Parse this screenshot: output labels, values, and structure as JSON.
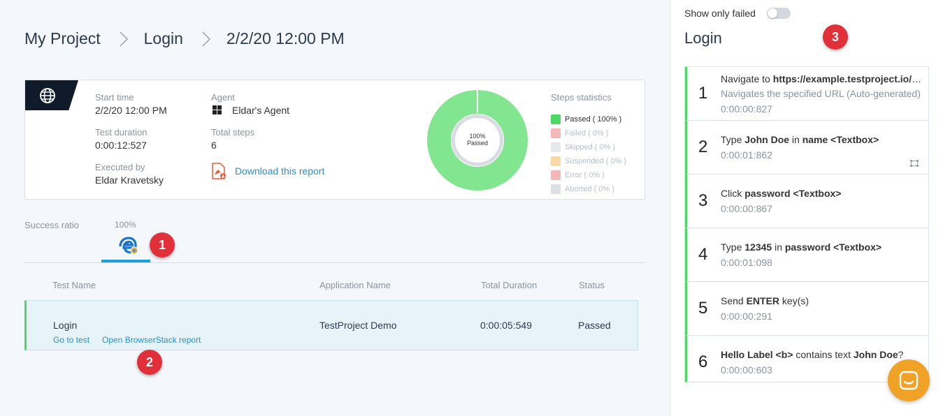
{
  "breadcrumb": {
    "project": "My Project",
    "test": "Login",
    "run": "2/2/20 12:00 PM"
  },
  "summary": {
    "start_time_label": "Start time",
    "start_time": "2/2/20 12:00 PM",
    "duration_label": "Test duration",
    "duration": "0:00:12:527",
    "executed_by_label": "Executed by",
    "executed_by": "Eldar Kravetsky",
    "agent_label": "Agent",
    "agent": "Eldar's Agent",
    "total_steps_label": "Total steps",
    "total_steps": "6",
    "download_label": "Download this report",
    "donut_pct": "100%",
    "donut_label": "Passed",
    "passed_fraction": 1.0,
    "stats_title": "Steps statistics",
    "stats": [
      {
        "label": "Passed ( 100% )",
        "color": "#4cd964",
        "active": true
      },
      {
        "label": "Failed ( 0% )",
        "color": "#f5b8b8",
        "active": false
      },
      {
        "label": "Skipped ( 0% )",
        "color": "#e6e8eb",
        "active": false
      },
      {
        "label": "Suspended ( 0% )",
        "color": "#fbd9a6",
        "active": false
      },
      {
        "label": "Error ( 0% )",
        "color": "#f5b8b8",
        "active": false
      },
      {
        "label": "Aborted ( 0% )",
        "color": "#dcdfe3",
        "active": false
      }
    ]
  },
  "success": {
    "label": "Success ratio",
    "value": "100%"
  },
  "table": {
    "headers": [
      "Test Name",
      "Application Name",
      "Total Duration",
      "Status"
    ],
    "row": {
      "name": "Login",
      "app": "TestProject Demo",
      "duration": "0:00:05:549",
      "status": "Passed",
      "link1": "Go to test",
      "link2": "Open BrowserStack report"
    }
  },
  "badges": {
    "b1": "1",
    "b2": "2",
    "b3": "3"
  },
  "side": {
    "toggle_label": "Show only failed",
    "title": "Login",
    "steps": [
      {
        "n": "1",
        "pre": "Navigate to ",
        "b1": "https://example.testproject.io/web/",
        "mid": "",
        "b2": "",
        "post": "",
        "desc": "Navigates the specified URL (Auto-generated)",
        "time": "0:00:00:827"
      },
      {
        "n": "2",
        "pre": "Type ",
        "b1": "John Doe",
        "mid": " in ",
        "b2": "name <Textbox>",
        "post": "",
        "desc": "",
        "time": "0:00:01:862"
      },
      {
        "n": "3",
        "pre": "Click ",
        "b1": "password <Textbox>",
        "mid": "",
        "b2": "",
        "post": "",
        "desc": "",
        "time": "0:00:00:867"
      },
      {
        "n": "4",
        "pre": "Type ",
        "b1": "12345",
        "mid": " in ",
        "b2": "password <Textbox>",
        "post": "",
        "desc": "",
        "time": "0:00:01:098"
      },
      {
        "n": "5",
        "pre": "Send ",
        "b1": "ENTER",
        "mid": " key(s)",
        "b2": "",
        "post": "",
        "desc": "",
        "time": "0:00:00:291"
      },
      {
        "n": "6",
        "pre": "",
        "b1": "Hello Label <b>",
        "mid": " contains text ",
        "b2": "John Doe",
        "post": "?",
        "desc": "",
        "time": "0:00:00:603"
      }
    ]
  },
  "colors": {
    "accent": "#1aa0d9",
    "passed": "#4cd964",
    "badge": "#e2303a",
    "chat": "#f0a226"
  }
}
